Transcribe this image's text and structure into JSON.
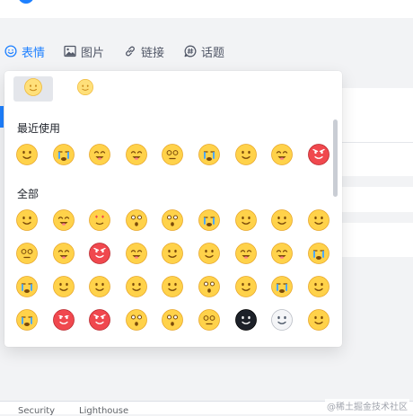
{
  "toolbar": {
    "emoji_label": "表情",
    "image_label": "图片",
    "link_label": "链接",
    "topic_label": "话题"
  },
  "colors": {
    "accent": "#1e80ff",
    "emoji_face": "#ffd24a",
    "emoji_angry": "#f0484e"
  },
  "picker": {
    "tabs": [
      {
        "icon": "smiley-face-icon",
        "active": true
      },
      {
        "icon": "smiley-face-icon",
        "active": false
      }
    ],
    "recent_title": "最近使用",
    "all_title": "全部",
    "recent": [
      "smile",
      "cry-loud",
      "lol",
      "grin-cheeky",
      "dizzy",
      "tearful-grimace",
      "smirk",
      "tongue-wink",
      "angry"
    ],
    "all": [
      "smile",
      "happy-squint",
      "heart-eyes",
      "surprised",
      "shocked",
      "crying",
      "smug",
      "puzzled",
      "sleepy-drool",
      "dizzy-sweat",
      "wink-tongue",
      "angry",
      "tongue-wink",
      "skeptical",
      "confused",
      "lol",
      "grin-cheeky",
      "cry-loud",
      "tearful-grimace",
      "sly",
      "smile",
      "eye-roll",
      "skeptical",
      "shocked",
      "thinking",
      "tears-of-joy",
      "smile",
      "sobbing",
      "headband-angry",
      "angry-glare",
      "question-confused",
      "shocked",
      "spiral-eyes",
      "black-face",
      "skull",
      "shaken"
    ]
  },
  "devtools": {
    "tab1": "Security",
    "tab2": "Lighthouse"
  },
  "watermark": "@稀土掘金技术社区"
}
